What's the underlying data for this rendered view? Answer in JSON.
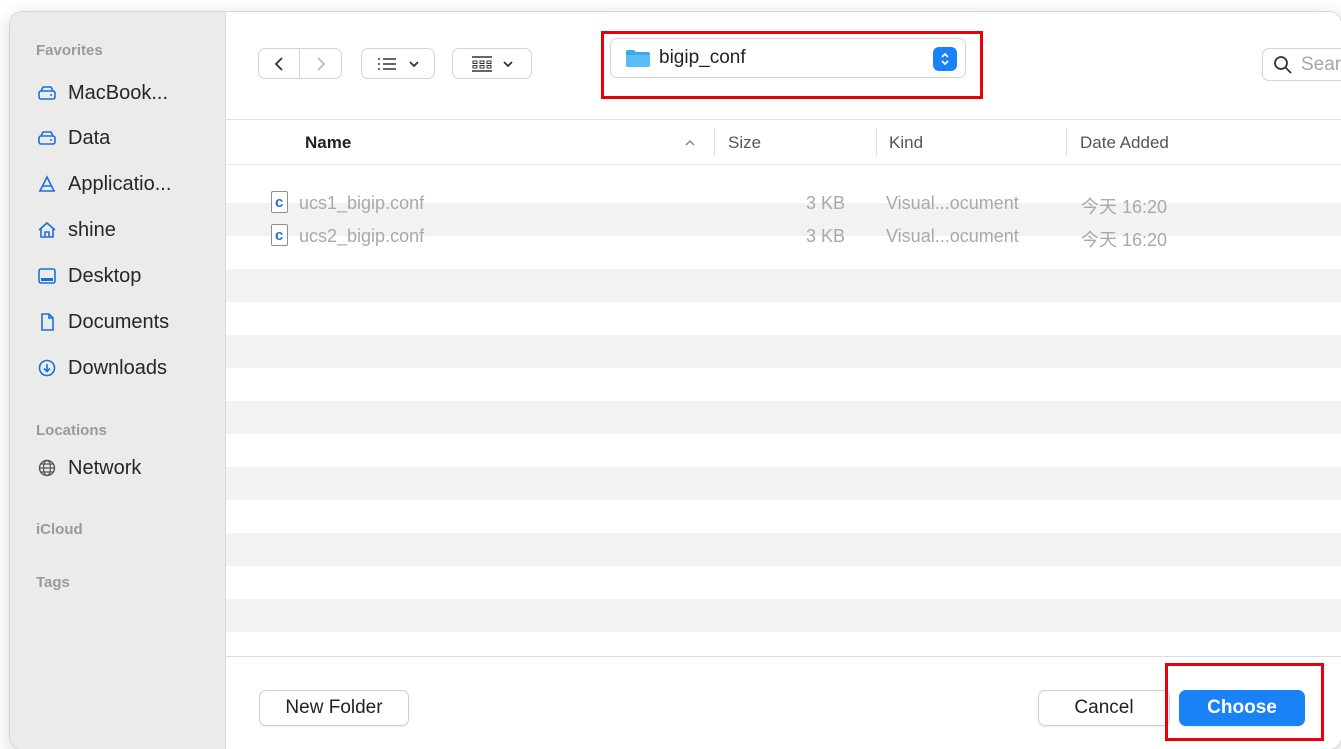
{
  "sidebar": {
    "favorites_label": "Favorites",
    "favorites": [
      {
        "label": "MacBook...",
        "icon": "drive-icon"
      },
      {
        "label": "Data",
        "icon": "drive-icon"
      },
      {
        "label": "Applicatio...",
        "icon": "applications-icon"
      },
      {
        "label": "shine",
        "icon": "home-icon"
      },
      {
        "label": "Desktop",
        "icon": "desktop-icon"
      },
      {
        "label": "Documents",
        "icon": "document-icon"
      },
      {
        "label": "Downloads",
        "icon": "downloads-icon"
      }
    ],
    "locations_label": "Locations",
    "locations": [
      {
        "label": "Network",
        "icon": "network-icon"
      }
    ],
    "icloud_label": "iCloud",
    "tags_label": "Tags"
  },
  "toolbar": {
    "current_folder": "bigip_conf",
    "search_placeholder": "Search"
  },
  "columns": {
    "name": "Name",
    "size": "Size",
    "kind": "Kind",
    "date_added": "Date Added"
  },
  "files": [
    {
      "name": "ucs1_bigip.conf",
      "size": "3 KB",
      "kind": "Visual...ocument",
      "date_added": "今天 16:20"
    },
    {
      "name": "ucs2_bigip.conf",
      "size": "3 KB",
      "kind": "Visual...ocument",
      "date_added": "今天 16:20"
    }
  ],
  "footer": {
    "new_folder_label": "New Folder",
    "cancel_label": "Cancel",
    "choose_label": "Choose"
  },
  "colors": {
    "accent": "#1a82f7",
    "highlight": "#e8000b",
    "sidebar_bg": "#ebebea",
    "stripe": "#f2f2f2"
  }
}
